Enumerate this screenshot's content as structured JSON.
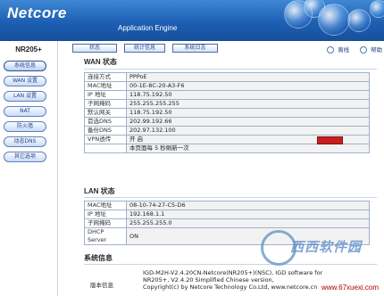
{
  "header": {
    "logo": "Netcore",
    "engine": "Application Engine"
  },
  "sidebar": {
    "model": "NR205+",
    "items": [
      "系统信息",
      "WAN 设置",
      "LAN 设置",
      "NAT",
      "防火墙",
      "动态DNS",
      "其它选项"
    ]
  },
  "tabs": [
    "状态",
    "统计信息",
    "系统日志"
  ],
  "top_links": {
    "offline": "离线",
    "help": "帮助"
  },
  "wan": {
    "title": "WAN 状态",
    "rows": [
      [
        "连接方式",
        "PPPoE"
      ],
      [
        "MAC地址",
        "00-1E-8C-20-A3-F6"
      ],
      [
        "IP 地址",
        "118.75.192.50"
      ],
      [
        "子网掩码",
        "255.255.255.255"
      ],
      [
        "默认网关",
        "118.75.192.50"
      ],
      [
        "首选DNS",
        "202.99.192.66"
      ],
      [
        "备份DNS",
        "202.97.132.100"
      ],
      [
        "VPN透传",
        "开 启"
      ],
      [
        "",
        "本页面每 5 秒刷新一次"
      ]
    ]
  },
  "lan": {
    "title": "LAN 状态",
    "rows": [
      [
        "MAC地址",
        "08-10-74-27-C5-D6"
      ],
      [
        "IP 地址",
        "192.168.1.1"
      ],
      [
        "子网掩码",
        "255.255.255.0"
      ],
      [
        "DHCP Server",
        "ON"
      ]
    ]
  },
  "system": {
    "title": "系统信息",
    "label": "版本信息",
    "version_lines": [
      "IGD-M2H-V2.4.20CN-Netcore(NR205+)(NSC), IGD software for",
      "NR205+, V2.4.20 Simplified Chinese version,",
      "Copyright(c) by Netcore Technology Co.Ltd, www.netcore.cn"
    ]
  },
  "watermark": {
    "text": "西西软件园"
  },
  "site": "www.67xuexi.com"
}
